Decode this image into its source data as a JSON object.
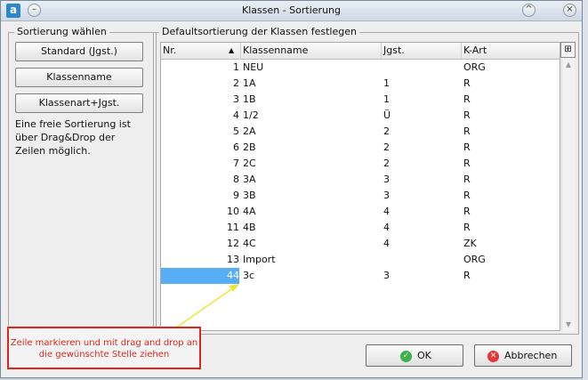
{
  "window": {
    "title": "Klassen - Sortierung",
    "app_icon_letter": "a"
  },
  "left_group": {
    "title": "Sortierung wählen",
    "buttons": [
      "Standard (Jgst.)",
      "Klassenname",
      "Klassenart+Jgst."
    ],
    "hint_lines": [
      "Eine freie Sortierung ist",
      "über Drag&Drop der",
      "Zeilen möglich."
    ]
  },
  "right_group": {
    "title": "Defaultsortierung der Klassen festlegen",
    "columns": [
      "Nr.",
      "Klassenname",
      "Jgst.",
      "K-Art"
    ],
    "sort_indicator": "▲",
    "rows": [
      {
        "nr": "1",
        "name": "NEU",
        "jgst": "",
        "kart": "ORG"
      },
      {
        "nr": "2",
        "name": "1A",
        "jgst": "1",
        "kart": "R"
      },
      {
        "nr": "3",
        "name": "1B",
        "jgst": "1",
        "kart": "R"
      },
      {
        "nr": "4",
        "name": "1/2",
        "jgst": "Ü",
        "kart": "R"
      },
      {
        "nr": "5",
        "name": "2A",
        "jgst": "2",
        "kart": "R"
      },
      {
        "nr": "6",
        "name": "2B",
        "jgst": "2",
        "kart": "R"
      },
      {
        "nr": "7",
        "name": "2C",
        "jgst": "2",
        "kart": "R"
      },
      {
        "nr": "8",
        "name": "3A",
        "jgst": "3",
        "kart": "R"
      },
      {
        "nr": "9",
        "name": "3B",
        "jgst": "3",
        "kart": "R"
      },
      {
        "nr": "10",
        "name": "4A",
        "jgst": "4",
        "kart": "R"
      },
      {
        "nr": "11",
        "name": "4B",
        "jgst": "4",
        "kart": "R"
      },
      {
        "nr": "12",
        "name": "4C",
        "jgst": "4",
        "kart": "ZK"
      },
      {
        "nr": "13",
        "name": "Import",
        "jgst": "",
        "kart": "ORG"
      },
      {
        "nr": "44",
        "name": "3c",
        "jgst": "3",
        "kart": "R",
        "selected": true
      }
    ]
  },
  "annotation": {
    "lines": [
      "Zeile markieren und mit drag and drop an",
      "die gewünschte Stelle ziehen"
    ],
    "color": "#e0261b"
  },
  "actions": {
    "ok_label": "OK",
    "cancel_label": "Abbrechen"
  },
  "colors": {
    "selection": "#58aef5",
    "ok_icon": "#3bb34a",
    "cancel_icon": "#e53535"
  }
}
